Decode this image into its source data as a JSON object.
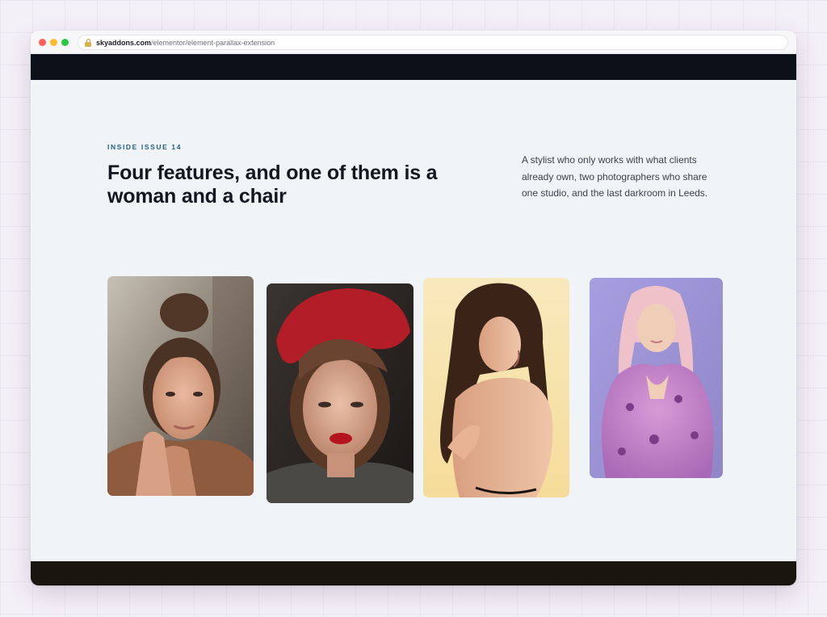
{
  "browser": {
    "url_host": "skyaddons.com",
    "url_path": "/elementor/element-parallax-extension"
  },
  "section": {
    "eyebrow": "INSIDE ISSUE 14",
    "headline": "Four features, and one of them is a woman and a chair",
    "description": "A stylist who only works with what clients already own, two photographers who share one studio, and the last darkroom in Leeds."
  },
  "gallery": {
    "photos": [
      {
        "subject": "woman-with-freckles-portrait",
        "accent": "#8c5a3c"
      },
      {
        "subject": "woman-in-red-beret-portrait",
        "accent": "#b01e2a"
      },
      {
        "subject": "woman-bare-back-yellow-backdrop",
        "accent": "#f6e2a6"
      },
      {
        "subject": "woman-pink-fur-coat-purple-backdrop",
        "accent": "#c78ad0"
      }
    ]
  },
  "colors": {
    "page_bg": "#f1f4f7",
    "header_bar": "#0b1019",
    "footer_bar": "#19150f",
    "eyebrow": "#1f5f8c",
    "headline": "#14171f"
  }
}
